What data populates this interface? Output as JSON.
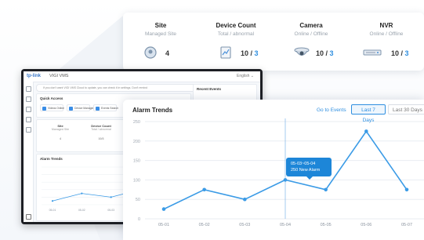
{
  "stats": [
    {
      "title": "Site",
      "subtitle": "Managed Site",
      "value": "4",
      "sep": "",
      "value2": "",
      "icon": "site-icon"
    },
    {
      "title": "Device Count",
      "subtitle": "Total / abnormal",
      "value": "10",
      "sep": " / ",
      "value2": "3",
      "icon": "device-icon"
    },
    {
      "title": "Camera",
      "subtitle": "Online / Offline",
      "value": "10",
      "sep": " / ",
      "value2": "3",
      "icon": "camera-icon"
    },
    {
      "title": "NVR",
      "subtitle": "Online / Offline",
      "value": "10",
      "sep": " / ",
      "value2": "3",
      "icon": "nvr-icon"
    }
  ],
  "laptop": {
    "brand": "tp-link",
    "site": "VIGI VMS",
    "language": "English ⌄",
    "notice": "If you don't want VIGI VMS Cloud to update, you can check it in settings. Don't remind",
    "quick_title": "Quick Access",
    "recent_title": "Recent Events",
    "quick_buttons": [
      "Videos Online",
      "Device Management",
      "Events Search"
    ],
    "mini_stats": [
      {
        "title": "Site",
        "sub": "Managed Site",
        "value": "4"
      },
      {
        "title": "Device Count",
        "sub": "Total / abnormal",
        "value": "10/3"
      },
      {
        "title": "Camera",
        "sub": "Online / Offline",
        "value": "10/3"
      }
    ],
    "mini_chart_title": "Alarm Trends",
    "mini_x": [
      "05-01",
      "05-02",
      "05-03",
      "05-04"
    ]
  },
  "alarm": {
    "title": "Alarm Trends",
    "link": "Go to Events",
    "tabs": [
      "Last 7 Days",
      "Last 30 Days"
    ],
    "tooltip_range": "05-03~05-04",
    "tooltip_value": "250 New Alarm"
  },
  "chart_data": {
    "type": "line",
    "title": "Alarm Trends",
    "x": [
      "05-01",
      "05-02",
      "05-03",
      "05-04",
      "05-05",
      "05-06",
      "05-07"
    ],
    "series": [
      {
        "values": [
          25,
          75,
          50,
          100,
          75,
          225,
          75
        ]
      }
    ],
    "ylim": [
      0,
      250
    ],
    "yticks": [
      0,
      50,
      100,
      150,
      200,
      250
    ],
    "grid": true,
    "color": "#3b9be6"
  }
}
